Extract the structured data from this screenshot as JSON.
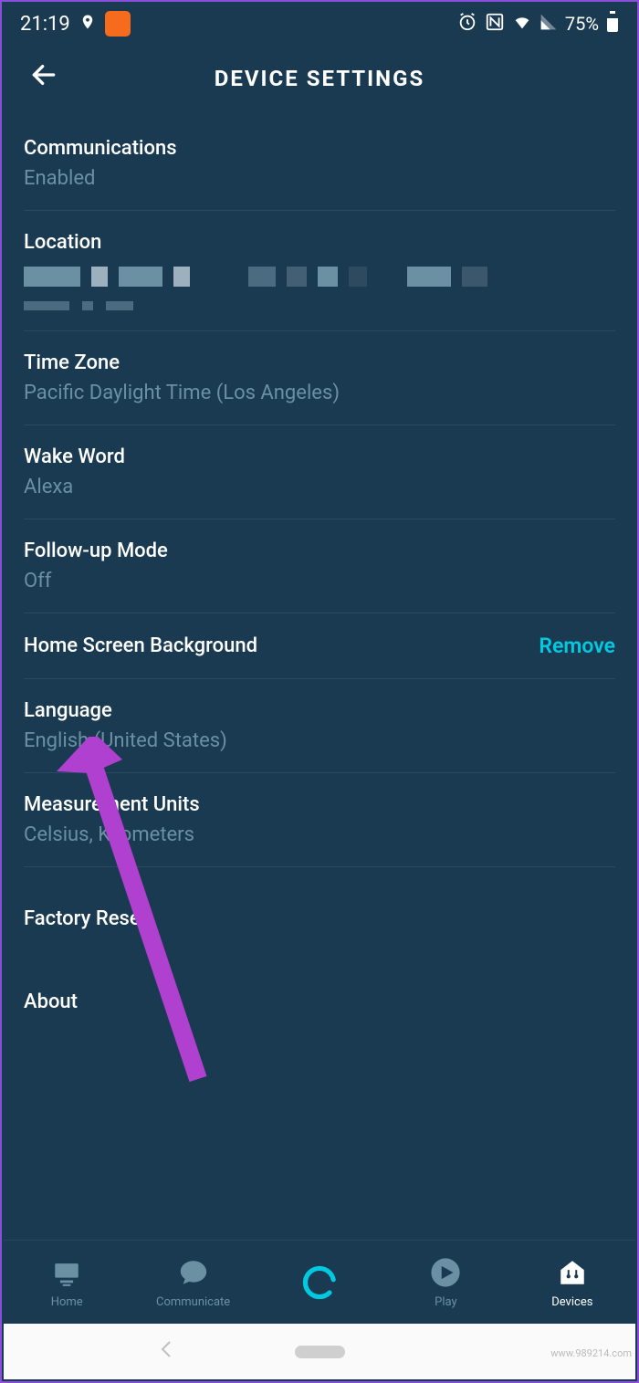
{
  "statusBar": {
    "time": "21:19",
    "battery": "75%"
  },
  "header": {
    "title": "DEVICE SETTINGS"
  },
  "settings": {
    "communications": {
      "label": "Communications",
      "value": "Enabled"
    },
    "location": {
      "label": "Location"
    },
    "timezone": {
      "label": "Time Zone",
      "value": "Pacific Daylight Time (Los Angeles)"
    },
    "wakeword": {
      "label": "Wake Word",
      "value": "Alexa"
    },
    "followup": {
      "label": "Follow-up Mode",
      "value": "Off"
    },
    "homescreen": {
      "label": "Home Screen Background",
      "action": "Remove"
    },
    "language": {
      "label": "Language",
      "value": "English (United States)"
    },
    "measurement": {
      "label": "Measurement Units",
      "value": "Celsius, Kilometers"
    },
    "factoryreset": {
      "label": "Factory Reset"
    },
    "about": {
      "label": "About"
    }
  },
  "nav": {
    "home": "Home",
    "communicate": "Communicate",
    "play": "Play",
    "devices": "Devices"
  },
  "watermark": "www.989214.com"
}
